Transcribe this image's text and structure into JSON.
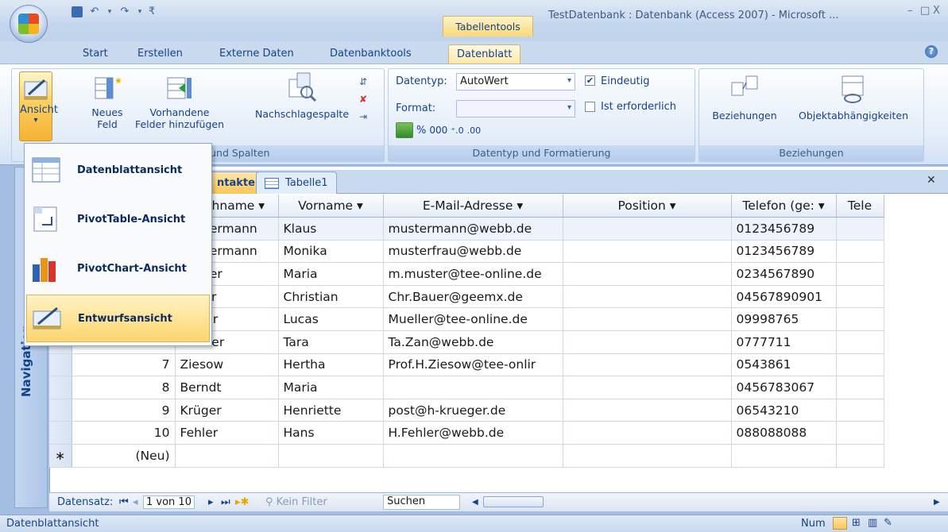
{
  "window": {
    "title": "TestDatenbank : Datenbank (Access 2007) - Microsoft ...",
    "context_tab": "Tabellentools",
    "controls": [
      "–",
      "□",
      "X"
    ]
  },
  "ribbon_tabs": [
    "Start",
    "Erstellen",
    "Externe Daten",
    "Datenbanktools",
    "Datenblatt"
  ],
  "active_tab": "Datenblatt",
  "ribbon": {
    "ansicht": {
      "label": "Ansicht",
      "arrow": "▾"
    },
    "neues_feld": "Neues Feld",
    "neues_feld_l1": "Neues",
    "neues_feld_l2": "Feld",
    "vorhandene_l1": "Vorhandene",
    "vorhandene_l2": "Felder hinzufügen",
    "nachschlagespalte": "Nachschlagespalte",
    "group1_label": "r und Spalten",
    "datentyp_label": "Datentyp:",
    "datentyp_value": "AutoWert",
    "format_label": "Format:",
    "format_value": "",
    "eindeutig_label": "Eindeutig",
    "eindeutig_checked": true,
    "erforderlich_label": "Ist erforderlich",
    "erforderlich_checked": false,
    "percent": "%",
    "thousands": "000",
    "group2_label": "Datentyp und Formatierung",
    "beziehungen": "Beziehungen",
    "objektabh": "Objektabhängigkeiten",
    "group3_label": "Beziehungen"
  },
  "ansicht_menu": [
    {
      "label": "Datenblattansicht",
      "icon": "datasheet-icon"
    },
    {
      "label": "PivotTable-Ansicht",
      "icon": "pivottable-icon"
    },
    {
      "label": "PivotChart-Ansicht",
      "icon": "pivotchart-icon"
    },
    {
      "label": "Entwurfsansicht",
      "icon": "design-icon",
      "highlighted": true
    }
  ],
  "navigation_label": "Navigation",
  "doc_tabs": [
    {
      "label": "ntakte",
      "active": true
    },
    {
      "label": "Tabelle1",
      "active": false
    }
  ],
  "grid": {
    "headers": [
      "",
      "Nachname",
      "Vorname",
      "E-Mail-Adresse",
      "Position",
      "Telefon (ge:",
      "Tele"
    ],
    "rows": [
      {
        "id": "",
        "nachname": "Mustermann",
        "vorname": "Klaus",
        "email": "mustermann@webb.de",
        "position": "",
        "telefon": "0123456789"
      },
      {
        "id": "",
        "nachname": "Mustermann",
        "vorname": "Monika",
        "email": "musterfrau@webb.de",
        "position": "",
        "telefon": "0123456789"
      },
      {
        "id": "",
        "nachname": "Muster",
        "vorname": "Maria",
        "email": "m.muster@tee-online.de",
        "position": "",
        "telefon": "0234567890"
      },
      {
        "id": "",
        "nachname": "Bauer",
        "vorname": "Christian",
        "email": "Chr.Bauer@geemx.de",
        "position": "",
        "telefon": "04567890901"
      },
      {
        "id": "",
        "nachname": "Müller",
        "vorname": "Lucas",
        "email": "Mueller@tee-online.de",
        "position": "",
        "telefon": "09998765"
      },
      {
        "id": "",
        "nachname": "Zander",
        "vorname": "Tara",
        "email": "Ta.Zan@webb.de",
        "position": "",
        "telefon": "0777711"
      },
      {
        "id": "7",
        "nachname": "Ziesow",
        "vorname": "Hertha",
        "email": "Prof.H.Ziesow@tee-onlir",
        "position": "",
        "telefon": "0543861"
      },
      {
        "id": "8",
        "nachname": "Berndt",
        "vorname": "Maria",
        "email": "",
        "position": "",
        "telefon": "0456783067"
      },
      {
        "id": "9",
        "nachname": "Krüger",
        "vorname": "Henriette",
        "email": "post@h-krueger.de",
        "position": "",
        "telefon": "06543210"
      },
      {
        "id": "10",
        "nachname": "Fehler",
        "vorname": "Hans",
        "email": "H.Fehler@webb.de",
        "position": "",
        "telefon": "088088088"
      }
    ],
    "new_row_marker": "∗",
    "new_row_label": "(Neu)"
  },
  "record_nav": {
    "label": "Datensatz:",
    "position": "1 von 10",
    "filter": "Kein Filter",
    "search": "Suchen"
  },
  "statusbar": {
    "left": "Datenblattansicht",
    "num": "Num"
  }
}
